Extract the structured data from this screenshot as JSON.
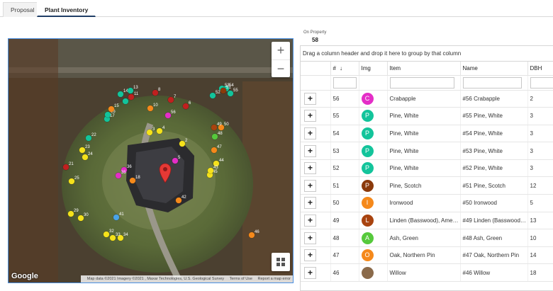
{
  "tabs": [
    {
      "label": "Proposal",
      "active": false
    },
    {
      "label": "Plant Inventory",
      "active": true
    }
  ],
  "map": {
    "google_logo": "Google",
    "attribution": [
      "Map data ©2021 Imagery ©2021 , Maxar Technologies, U.S. Geological Survey",
      "Terms of Use",
      "Report a map error"
    ],
    "zoom_in_label": "+",
    "zoom_out_label": "−",
    "icons": {
      "zoom_in": "plus-icon",
      "zoom_out": "minus-icon",
      "layers": "grid-icon",
      "location": "map-pin-icon"
    },
    "markers": [
      {
        "label": "56",
        "color": "#e42ec7"
      },
      {
        "label": "55",
        "color": "#13c49b"
      },
      {
        "label": "54",
        "color": "#13c49b"
      },
      {
        "label": "53",
        "color": "#13c49b"
      },
      {
        "label": "52",
        "color": "#13c49b"
      },
      {
        "label": "51",
        "color": "#8b3a0b"
      },
      {
        "label": "50",
        "color": "#f5891b"
      },
      {
        "label": "49",
        "color": "#a8430f"
      },
      {
        "label": "48",
        "color": "#56c93c"
      },
      {
        "label": "47",
        "color": "#f5891b"
      },
      {
        "label": "46",
        "color": "#f5891b"
      },
      {
        "label": "45",
        "color": "#f5e21b"
      },
      {
        "label": "44",
        "color": "#f5e21b"
      },
      {
        "label": "43",
        "color": "#f5e21b"
      },
      {
        "label": "42",
        "color": "#f5891b"
      },
      {
        "label": "41",
        "color": "#4aa3e8"
      },
      {
        "label": "36",
        "color": "#e42ec7"
      },
      {
        "label": "35",
        "color": "#e42ec7"
      },
      {
        "label": "34",
        "color": "#f5e21b"
      },
      {
        "label": "33",
        "color": "#f5e21b"
      },
      {
        "label": "32",
        "color": "#f5e21b"
      },
      {
        "label": "30",
        "color": "#f5e21b"
      },
      {
        "label": "29",
        "color": "#f5e21b"
      },
      {
        "label": "25",
        "color": "#f5e21b"
      },
      {
        "label": "24",
        "color": "#f5e21b"
      },
      {
        "label": "23",
        "color": "#f5e21b"
      },
      {
        "label": "22",
        "color": "#13c49b"
      },
      {
        "label": "21",
        "color": "#c0201f"
      },
      {
        "label": "18",
        "color": "#f5891b"
      },
      {
        "label": "17",
        "color": "#13c49b"
      },
      {
        "label": "16",
        "color": "#13c49b"
      },
      {
        "label": "15",
        "color": "#f5891b"
      },
      {
        "label": "14",
        "color": "#13c49b"
      },
      {
        "label": "13",
        "color": "#13c49b"
      },
      {
        "label": "12",
        "color": "#13c49b"
      },
      {
        "label": "11",
        "color": "#c0201f"
      },
      {
        "label": "10",
        "color": "#f5891b"
      },
      {
        "label": "8",
        "color": "#c0201f"
      },
      {
        "label": "7",
        "color": "#c0201f"
      },
      {
        "label": "6",
        "color": "#c0201f"
      },
      {
        "label": "5",
        "color": "#e42ec7"
      },
      {
        "label": "4",
        "color": "#f5e21b"
      },
      {
        "label": "3",
        "color": "#f5e21b"
      },
      {
        "label": "2",
        "color": "#f5e21b"
      }
    ]
  },
  "summary": {
    "label": "On Property",
    "count": "58"
  },
  "grid": {
    "group_hint": "Drag a column header and drop it here to group by that column",
    "columns": [
      "#",
      "Img",
      "Item",
      "Name",
      "DBH"
    ],
    "sort_icon": "arrow-down-icon",
    "expand_label": "+",
    "rows": [
      {
        "num": "56",
        "letter": "C",
        "color": "#e42ec7",
        "item": "Crabapple",
        "name": "#56 Crabapple",
        "dbh": "2"
      },
      {
        "num": "55",
        "letter": "P",
        "color": "#13c49b",
        "item": "Pine, White",
        "name": "#55 Pine, White",
        "dbh": "3"
      },
      {
        "num": "54",
        "letter": "P",
        "color": "#13c49b",
        "item": "Pine, White",
        "name": "#54 Pine, White",
        "dbh": "3"
      },
      {
        "num": "53",
        "letter": "P",
        "color": "#13c49b",
        "item": "Pine, White",
        "name": "#53 Pine, White",
        "dbh": "3"
      },
      {
        "num": "52",
        "letter": "P",
        "color": "#13c49b",
        "item": "Pine, White",
        "name": "#52 Pine, White",
        "dbh": "3"
      },
      {
        "num": "51",
        "letter": "P",
        "color": "#8b3a0b",
        "item": "Pine, Scotch",
        "name": "#51 Pine, Scotch",
        "dbh": "12"
      },
      {
        "num": "50",
        "letter": "I",
        "color": "#f5891b",
        "item": "Ironwood",
        "name": "#50 Ironwood",
        "dbh": "5"
      },
      {
        "num": "49",
        "letter": "L",
        "color": "#a8430f",
        "item": "Linden (Basswood), American",
        "name": "#49 Linden (Basswood), ...",
        "dbh": "13"
      },
      {
        "num": "48",
        "letter": "A",
        "color": "#56c93c",
        "item": "Ash, Green",
        "name": "#48 Ash, Green",
        "dbh": "10"
      },
      {
        "num": "47",
        "letter": "O",
        "color": "#f5891b",
        "item": "Oak, Northern Pin",
        "name": "#47 Oak, Northern Pin",
        "dbh": "14"
      },
      {
        "num": "46",
        "letter": "",
        "color": "#8a6a4a",
        "item": "Willow",
        "name": "#46 Willow",
        "dbh": "18"
      }
    ]
  }
}
